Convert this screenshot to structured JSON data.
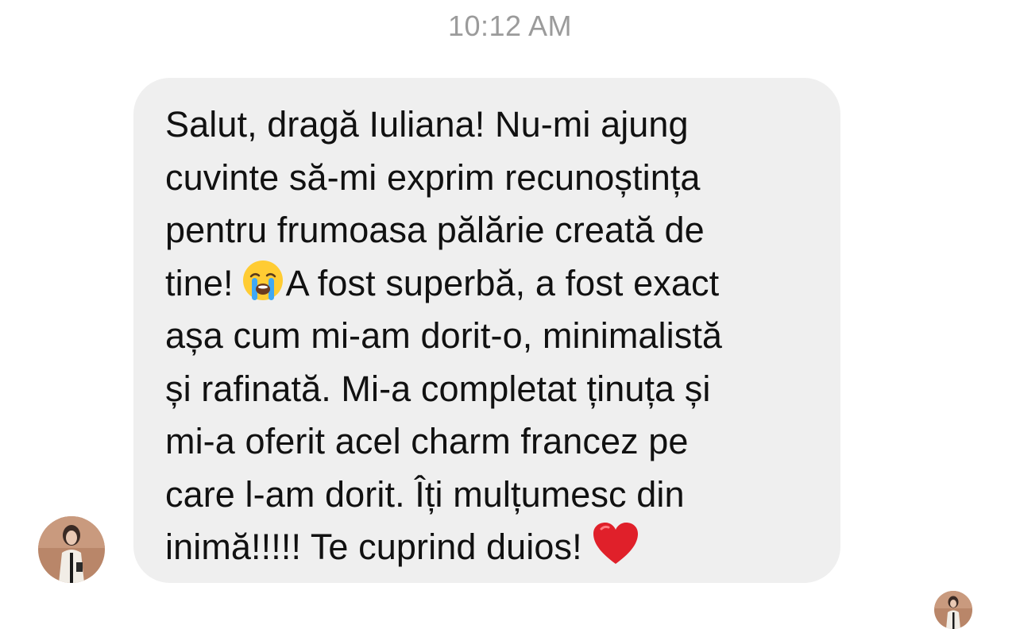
{
  "timestamp": "10:12 AM",
  "message": {
    "lines": [
      "Salut, dragă Iuliana! Nu-mi ajung",
      "cuvinte să-mi exprim recunoștința",
      "pentru frumoasa pălărie creată de",
      "tine!",
      "A fost superbă, a fost exact",
      "așa cum mi-am dorit-o, minimalistă",
      "și rafinată. Mi-a completat ținuța și",
      "mi-a oferit acel charm francez pe",
      "care l-am dorit. Îți mulțumesc din",
      "inimă!!!!! Te cuprind duios!"
    ],
    "emojis": [
      "loudly-crying-face-icon",
      "red-heart-icon"
    ]
  },
  "colors": {
    "bubble": "#efefef",
    "timestamp": "#9b9b9b",
    "text": "#111111"
  }
}
